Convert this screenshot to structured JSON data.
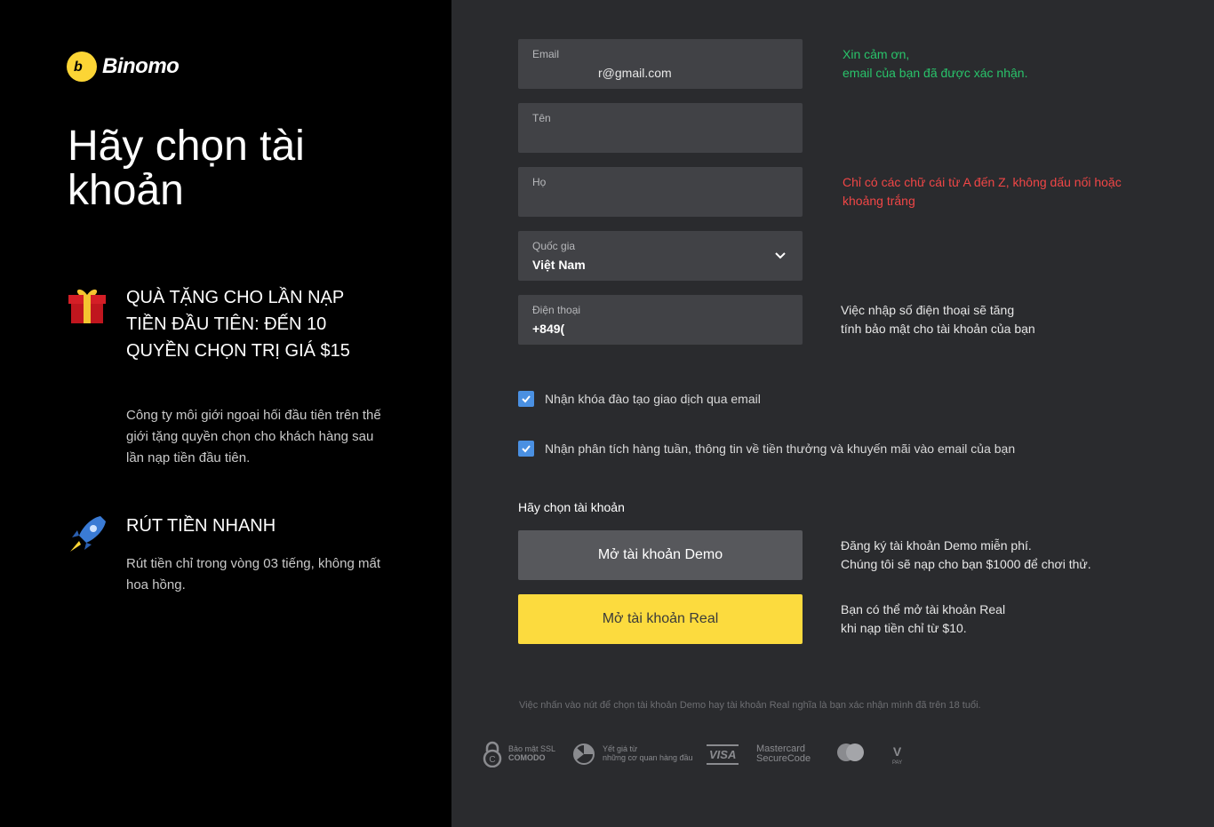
{
  "brand": {
    "name": "Binomo",
    "mark": "b"
  },
  "left": {
    "title": "Hãy chọn tài khoản",
    "features": [
      {
        "icon": "gift-icon",
        "title": "QUÀ TẶNG CHO LẦN NẠP TIỀN ĐẦU TIÊN: ĐẾN 10 QUYỀN CHỌN TRỊ GIÁ $15",
        "description": "Công ty môi giới ngoại hối đầu tiên trên thế giới tặng quyền chọn cho khách hàng sau lần nạp tiền đầu tiên."
      },
      {
        "icon": "rocket-icon",
        "title": "RÚT TIỀN NHANH",
        "description": "Rút tiền chỉ trong vòng 03 tiếng, không mất hoa hồng."
      }
    ]
  },
  "form": {
    "email": {
      "label": "Email",
      "value": "r@gmail.com",
      "hint_line1": "Xin cảm ơn,",
      "hint_line2": "email của bạn đã được xác nhận."
    },
    "first_name": {
      "label": "Tên",
      "value": ""
    },
    "last_name": {
      "label": "Họ",
      "value": "",
      "hint_line1": "Chỉ có các chữ cái từ A đến Z, không dấu nối hoặc",
      "hint_line2": "khoảng trắng"
    },
    "country": {
      "label": "Quốc gia",
      "value": "Việt Nam"
    },
    "phone": {
      "label": "Điện thoại",
      "value": "+849(",
      "hint_line1": "Việc nhập số điện thoại sẽ tăng",
      "hint_line2": "tính bảo mật cho tài khoản của bạn"
    },
    "checkbox_training": "Nhận khóa đào tạo giao dịch qua email",
    "checkbox_weekly": "Nhận phân tích hàng tuần, thông tin về tiền thưởng và khuyến mãi vào email của bạn",
    "choose_label": "Hãy chọn tài khoản",
    "demo_button": "Mở tài khoản Demo",
    "demo_hint_line1": "Đăng ký tài khoản Demo miễn phí.",
    "demo_hint_line2": "Chúng tôi sẽ nạp cho bạn $1000 để chơi thử.",
    "real_button": "Mở tài khoản Real",
    "real_hint_line1": "Bạn có thể mở tài khoản Real",
    "real_hint_line2": "khi nạp tiền chỉ từ $10.",
    "disclaimer": "Việc nhấn vào nút để chọn tài khoản Demo hay tài khoản Real nghĩa là bạn xác nhận mình đã trên 18 tuổi."
  },
  "badges": {
    "ssl_line1": "Bảo mật SSL",
    "ssl_line2": "COMODO",
    "rated_line1": "Yết giá từ",
    "rated_line2": "những cơ quan hàng đầu",
    "visa": "VISA",
    "mastercard_line1": "Mastercard",
    "mastercard_line2": "SecureCode",
    "vpay_line1": "V",
    "vpay_line2": "PAY"
  },
  "colors": {
    "accent": "#fcd535",
    "button_real": "#fcdb3e",
    "success": "#29c36a",
    "error": "#f04646",
    "checkbox": "#4a90e2"
  }
}
